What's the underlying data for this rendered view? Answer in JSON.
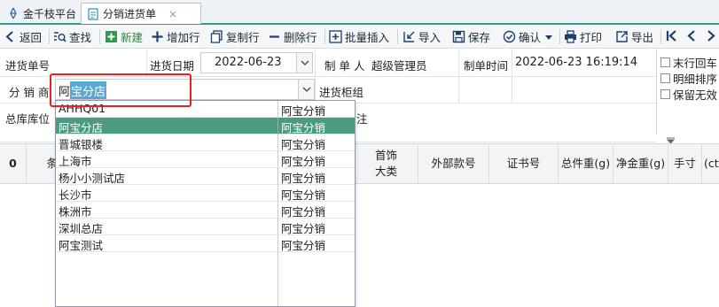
{
  "tabs": [
    {
      "label": "金千枝平台",
      "icon": "app-logo-icon"
    },
    {
      "label": "分销进货单",
      "icon": "document-icon",
      "close": "×"
    }
  ],
  "toolbar": {
    "back": "返回",
    "find": "查找",
    "new": "新建",
    "add_row": "增加行",
    "copy_row": "复制行",
    "delete_row": "删除行",
    "batch_insert": "批量插入",
    "import": "导入",
    "save": "保存",
    "confirm": "确认",
    "print": "打印",
    "export": "导出"
  },
  "form": {
    "purchase_no_label": "进货单号",
    "purchase_date_label": "进货日期",
    "purchase_date_value": "2022-06-23",
    "creator_label": "制 单 人",
    "creator_value": "超级管理员",
    "create_time_label": "制单时间",
    "create_time_value": "2022-06-23 16:19:14",
    "distributor_label": "分 销 商",
    "distributor_value_prefix": "阿",
    "distributor_value_selected": "宝分店",
    "counter_label": "进货柜组",
    "warehouse_label": "总库库位",
    "remark_label_partial": "注"
  },
  "options": {
    "last_row_enter": "末行回车",
    "detail_sort": "明细排序",
    "keep_invalid": "保留无效"
  },
  "grid": {
    "row_number": "0",
    "col_partial": "条",
    "headers": [
      "首饰\n大类",
      "外部款号",
      "证书号",
      "总件重(g)",
      "净金重(g)",
      "手寸",
      "(ct"
    ]
  },
  "dropdown": {
    "rows": [
      {
        "name": "AHHQ01",
        "type": "阿宝分销",
        "selected": false
      },
      {
        "name": "阿宝分店",
        "type": "阿宝分销",
        "selected": true
      },
      {
        "name": "晋城银楼",
        "type": "阿宝分销",
        "selected": false
      },
      {
        "name": "上海市",
        "type": "阿宝分销",
        "selected": false
      },
      {
        "name": "杨小小测试店",
        "type": "阿宝分销",
        "selected": false
      },
      {
        "name": "长沙市",
        "type": "阿宝分销",
        "selected": false
      },
      {
        "name": "株洲市",
        "type": "阿宝分销",
        "selected": false
      },
      {
        "name": "深圳总店",
        "type": "阿宝分销",
        "selected": false
      },
      {
        "name": "阿宝测试",
        "type": "阿宝分销",
        "selected": false
      }
    ]
  },
  "colors": {
    "accent": "#2f9e8f",
    "selected_row": "#4c9a82",
    "highlight": "#e8231f",
    "text_selection": "#5aa8d6"
  }
}
